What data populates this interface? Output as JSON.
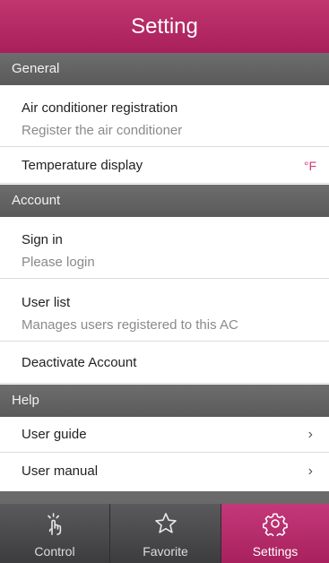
{
  "header": {
    "title": "Setting"
  },
  "general": {
    "heading": "General",
    "ac_registration": {
      "title": "Air conditioner registration",
      "subtitle": "Register the air conditioner"
    },
    "temperature_display": {
      "title": "Temperature display",
      "value": "°F"
    }
  },
  "account": {
    "heading": "Account",
    "sign_in": {
      "title": "Sign in",
      "subtitle": "Please login"
    },
    "user_list": {
      "title": "User list",
      "subtitle": "Manages users registered to this AC"
    },
    "deactivate": {
      "title": "Deactivate Account"
    }
  },
  "help": {
    "heading": "Help",
    "user_guide": {
      "title": "User guide",
      "chevron": "›"
    },
    "user_manual": {
      "title": "User manual",
      "chevron": "›"
    }
  },
  "tabs": {
    "control": {
      "label": "Control",
      "icon": "hand-tap-icon"
    },
    "favorite": {
      "label": "Favorite",
      "icon": "star-icon"
    },
    "settings": {
      "label": "Settings",
      "icon": "gear-icon",
      "active": true
    }
  },
  "colors": {
    "accent": "#b02a64",
    "value_text": "#d8367a",
    "section_bg": "#636363"
  }
}
